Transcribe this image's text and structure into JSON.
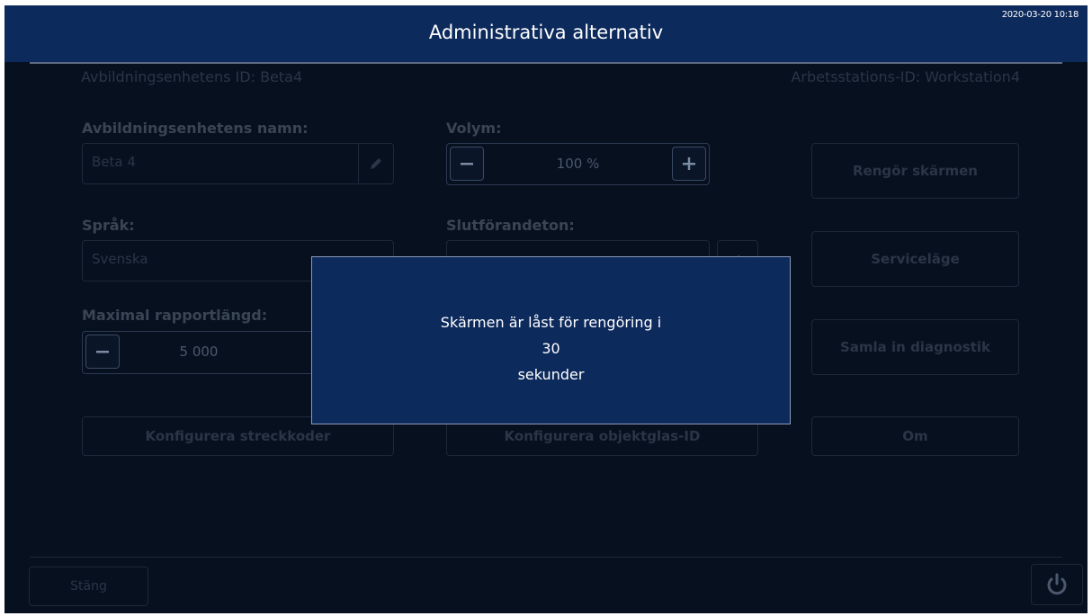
{
  "header": {
    "title": "Administrativa alternativ",
    "timestamp": "2020-03-20 10:18"
  },
  "info": {
    "device_id": "Avbildningsenhetens ID: Beta4",
    "workstation_id": "Arbetsstations-ID: Workstation4"
  },
  "settings": {
    "device_name_label": "Avbildningsenhetens namn:",
    "device_name_value": "Beta 4",
    "language_label": "Språk:",
    "language_value": "Svenska",
    "max_report_length_label": "Maximal rapportlängd:",
    "max_report_length_value": "5 000",
    "volume_label": "Volym:",
    "volume_value": "100 %",
    "completion_tone_label": "Slutförandeton:"
  },
  "buttons": {
    "configure_barcodes": "Konfigurera streckkoder",
    "configure_slide_id": "Konfigurera objektglas-ID",
    "clean_screen": "Rengör skärmen",
    "service_mode": "Serviceläge",
    "collect_diagnostics": "Samla in diagnostik",
    "about": "Om",
    "close": "Stäng"
  },
  "modal": {
    "line1": "Skärmen är låst för rengöring i",
    "seconds": "30",
    "line3": "sekunder"
  },
  "icons": {
    "edit": "pencil-icon",
    "minus": "minus-icon",
    "plus": "plus-icon",
    "sound": "speaker-icon",
    "power": "power-icon"
  },
  "colors": {
    "header_bg": "#0d2a5c",
    "screen_bg": "#07101f",
    "modal_bg": "#0d2a5c"
  }
}
